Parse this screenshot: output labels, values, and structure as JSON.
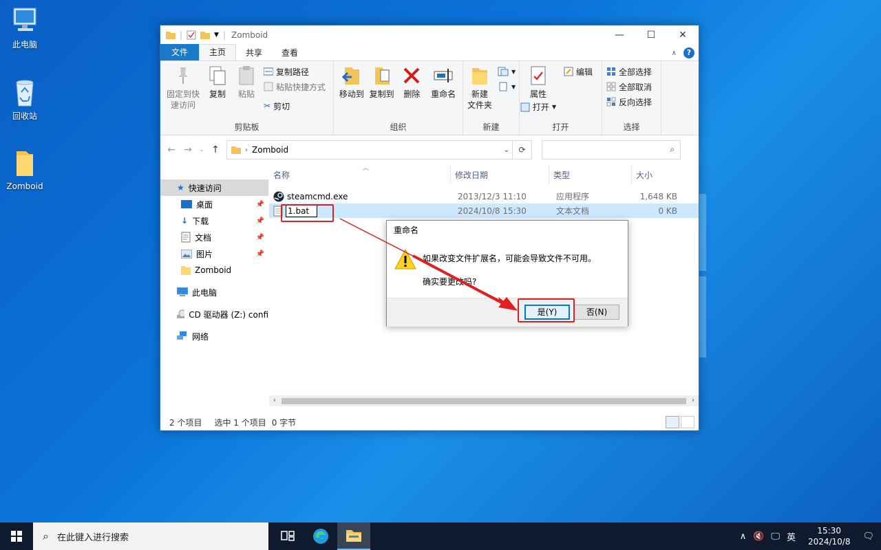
{
  "desktop": {
    "icons": [
      {
        "label": "此电脑",
        "icon": "computer-icon"
      },
      {
        "label": "回收站",
        "icon": "recycle-bin-icon"
      },
      {
        "label": "Zomboid",
        "icon": "folder-icon"
      }
    ]
  },
  "window": {
    "title": "Zomboid",
    "controls": {
      "minimize": "—",
      "maximize": "☐",
      "close": "✕"
    },
    "tabs": [
      "文件",
      "主页",
      "共享",
      "查看"
    ],
    "active_tab": "主页",
    "ribbon": {
      "clipboard": {
        "name": "剪贴板",
        "pin": "固定到快速访问",
        "pin_line1": "固定到快",
        "pin_line2": "速访问",
        "copy": "复制",
        "paste": "粘贴",
        "copy_path": "复制路径",
        "paste_shortcut": "粘贴快捷方式",
        "cut": "剪切"
      },
      "organize": {
        "name": "组织",
        "move_to": "移动到",
        "copy_to": "复制到",
        "delete": "删除",
        "rename": "重命名"
      },
      "new": {
        "name": "新建",
        "new_folder_line1": "新建",
        "new_folder_line2": "文件夹"
      },
      "open": {
        "name": "打开",
        "properties": "属性",
        "open": "打开",
        "edit": "编辑"
      },
      "select": {
        "name": "选择",
        "select_all": "全部选择",
        "select_none": "全部取消",
        "invert": "反向选择"
      }
    },
    "address": {
      "path_item": "Zomboid",
      "search_placeholder": ""
    },
    "nav": [
      {
        "label": "快速访问",
        "icon": "star-icon",
        "selected": true
      },
      {
        "label": "桌面",
        "icon": "desktop-icon",
        "pinned": true
      },
      {
        "label": "下载",
        "icon": "download-icon",
        "pinned": true
      },
      {
        "label": "文档",
        "icon": "document-icon",
        "pinned": true
      },
      {
        "label": "图片",
        "icon": "picture-icon",
        "pinned": true
      },
      {
        "label": "Zomboid",
        "icon": "folder-icon"
      },
      {
        "label": "此电脑",
        "icon": "computer-icon"
      },
      {
        "label": "CD 驱动器 (Z:) confi",
        "icon": "cd-drive-icon"
      },
      {
        "label": "网络",
        "icon": "network-icon"
      }
    ],
    "columns": [
      "名称",
      "修改日期",
      "类型",
      "大小"
    ],
    "files": [
      {
        "name": "steamcmd.exe",
        "date": "2013/12/3 11:10",
        "type": "应用程序",
        "size": "1,648 KB"
      },
      {
        "name": "1.bat",
        "date": "2024/10/8 15:30",
        "type": "文本文档",
        "size": "0 KB"
      }
    ],
    "status": {
      "count": "2 个项目",
      "selected": "选中 1 个项目",
      "size": "0 字节"
    }
  },
  "dialog": {
    "title": "重命名",
    "message": "如果改变文件扩展名，可能会导致文件不可用。",
    "question": "确实要更改吗?",
    "yes": "是(Y)",
    "no": "否(N)"
  },
  "taskbar": {
    "search_placeholder": "在此键入进行搜索",
    "ime": "英",
    "time": "15:30",
    "date": "2024/10/8"
  }
}
